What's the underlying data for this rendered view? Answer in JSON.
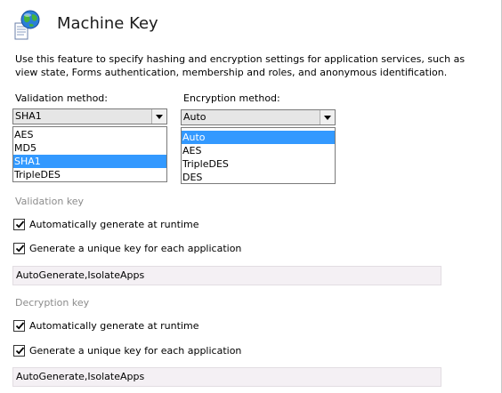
{
  "header": {
    "title": "Machine Key",
    "description": "Use this feature to specify hashing and encryption settings for application services, such as view state, Forms authentication, membership and roles, and anonymous identification."
  },
  "validation_method": {
    "label": "Validation method:",
    "selected": "SHA1",
    "options": [
      "AES",
      "MD5",
      "SHA1",
      "TripleDES"
    ],
    "highlighted": "SHA1"
  },
  "encryption_method": {
    "label": "Encryption method:",
    "selected": "Auto",
    "options": [
      "Auto",
      "AES",
      "TripleDES",
      "DES"
    ],
    "highlighted": "Auto"
  },
  "validation_key": {
    "section_label": "Validation key",
    "auto_generate": {
      "label": "Automatically generate at runtime",
      "checked": true
    },
    "unique_key": {
      "label": "Generate a unique key for each application",
      "checked": true
    },
    "value": "AutoGenerate,IsolateApps"
  },
  "decryption_key": {
    "section_label": "Decryption key",
    "auto_generate": {
      "label": "Automatically generate at runtime",
      "checked": true
    },
    "unique_key": {
      "label": "Generate a unique key for each application",
      "checked": true
    },
    "value": "AutoGenerate,IsolateApps"
  },
  "colors": {
    "selection": "#3399ff",
    "section_label": "#8c8c8c",
    "textbox_bg": "#f4f0f4"
  }
}
